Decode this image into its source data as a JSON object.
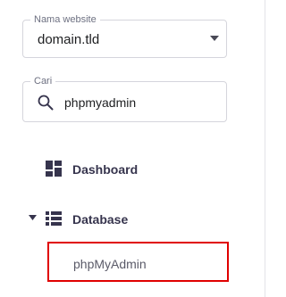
{
  "website_select": {
    "label": "Nama website",
    "value": "domain.tld"
  },
  "search": {
    "label": "Cari",
    "value": "phpmyadmin"
  },
  "nav": {
    "dashboard": {
      "label": "Dashboard",
      "icon": "dashboard-icon"
    },
    "database": {
      "label": "Database",
      "icon": "database-icon",
      "expanded": true,
      "children": [
        {
          "label": "phpMyAdmin",
          "highlighted": true
        }
      ]
    }
  },
  "colors": {
    "highlight_border": "#e00000",
    "nav_text": "#36344d",
    "field_border": "#d5d5dc"
  }
}
